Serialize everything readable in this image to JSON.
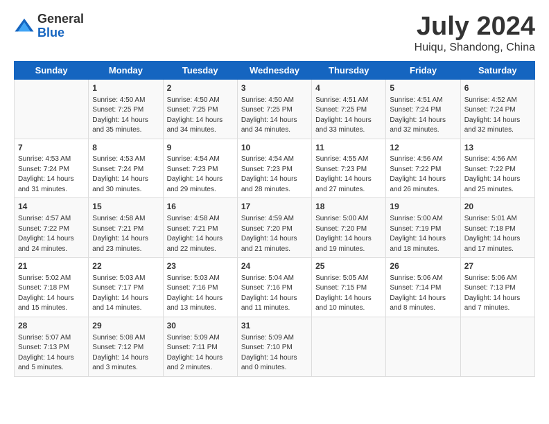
{
  "logo": {
    "general": "General",
    "blue": "Blue"
  },
  "title": "July 2024",
  "subtitle": "Huiqu, Shandong, China",
  "days_of_week": [
    "Sunday",
    "Monday",
    "Tuesday",
    "Wednesday",
    "Thursday",
    "Friday",
    "Saturday"
  ],
  "weeks": [
    [
      {
        "day": "",
        "content": ""
      },
      {
        "day": "1",
        "content": "Sunrise: 4:50 AM\nSunset: 7:25 PM\nDaylight: 14 hours\nand 35 minutes."
      },
      {
        "day": "2",
        "content": "Sunrise: 4:50 AM\nSunset: 7:25 PM\nDaylight: 14 hours\nand 34 minutes."
      },
      {
        "day": "3",
        "content": "Sunrise: 4:50 AM\nSunset: 7:25 PM\nDaylight: 14 hours\nand 34 minutes."
      },
      {
        "day": "4",
        "content": "Sunrise: 4:51 AM\nSunset: 7:25 PM\nDaylight: 14 hours\nand 33 minutes."
      },
      {
        "day": "5",
        "content": "Sunrise: 4:51 AM\nSunset: 7:24 PM\nDaylight: 14 hours\nand 32 minutes."
      },
      {
        "day": "6",
        "content": "Sunrise: 4:52 AM\nSunset: 7:24 PM\nDaylight: 14 hours\nand 32 minutes."
      }
    ],
    [
      {
        "day": "7",
        "content": "Sunrise: 4:53 AM\nSunset: 7:24 PM\nDaylight: 14 hours\nand 31 minutes."
      },
      {
        "day": "8",
        "content": "Sunrise: 4:53 AM\nSunset: 7:24 PM\nDaylight: 14 hours\nand 30 minutes."
      },
      {
        "day": "9",
        "content": "Sunrise: 4:54 AM\nSunset: 7:23 PM\nDaylight: 14 hours\nand 29 minutes."
      },
      {
        "day": "10",
        "content": "Sunrise: 4:54 AM\nSunset: 7:23 PM\nDaylight: 14 hours\nand 28 minutes."
      },
      {
        "day": "11",
        "content": "Sunrise: 4:55 AM\nSunset: 7:23 PM\nDaylight: 14 hours\nand 27 minutes."
      },
      {
        "day": "12",
        "content": "Sunrise: 4:56 AM\nSunset: 7:22 PM\nDaylight: 14 hours\nand 26 minutes."
      },
      {
        "day": "13",
        "content": "Sunrise: 4:56 AM\nSunset: 7:22 PM\nDaylight: 14 hours\nand 25 minutes."
      }
    ],
    [
      {
        "day": "14",
        "content": "Sunrise: 4:57 AM\nSunset: 7:22 PM\nDaylight: 14 hours\nand 24 minutes."
      },
      {
        "day": "15",
        "content": "Sunrise: 4:58 AM\nSunset: 7:21 PM\nDaylight: 14 hours\nand 23 minutes."
      },
      {
        "day": "16",
        "content": "Sunrise: 4:58 AM\nSunset: 7:21 PM\nDaylight: 14 hours\nand 22 minutes."
      },
      {
        "day": "17",
        "content": "Sunrise: 4:59 AM\nSunset: 7:20 PM\nDaylight: 14 hours\nand 21 minutes."
      },
      {
        "day": "18",
        "content": "Sunrise: 5:00 AM\nSunset: 7:20 PM\nDaylight: 14 hours\nand 19 minutes."
      },
      {
        "day": "19",
        "content": "Sunrise: 5:00 AM\nSunset: 7:19 PM\nDaylight: 14 hours\nand 18 minutes."
      },
      {
        "day": "20",
        "content": "Sunrise: 5:01 AM\nSunset: 7:18 PM\nDaylight: 14 hours\nand 17 minutes."
      }
    ],
    [
      {
        "day": "21",
        "content": "Sunrise: 5:02 AM\nSunset: 7:18 PM\nDaylight: 14 hours\nand 15 minutes."
      },
      {
        "day": "22",
        "content": "Sunrise: 5:03 AM\nSunset: 7:17 PM\nDaylight: 14 hours\nand 14 minutes."
      },
      {
        "day": "23",
        "content": "Sunrise: 5:03 AM\nSunset: 7:16 PM\nDaylight: 14 hours\nand 13 minutes."
      },
      {
        "day": "24",
        "content": "Sunrise: 5:04 AM\nSunset: 7:16 PM\nDaylight: 14 hours\nand 11 minutes."
      },
      {
        "day": "25",
        "content": "Sunrise: 5:05 AM\nSunset: 7:15 PM\nDaylight: 14 hours\nand 10 minutes."
      },
      {
        "day": "26",
        "content": "Sunrise: 5:06 AM\nSunset: 7:14 PM\nDaylight: 14 hours\nand 8 minutes."
      },
      {
        "day": "27",
        "content": "Sunrise: 5:06 AM\nSunset: 7:13 PM\nDaylight: 14 hours\nand 7 minutes."
      }
    ],
    [
      {
        "day": "28",
        "content": "Sunrise: 5:07 AM\nSunset: 7:13 PM\nDaylight: 14 hours\nand 5 minutes."
      },
      {
        "day": "29",
        "content": "Sunrise: 5:08 AM\nSunset: 7:12 PM\nDaylight: 14 hours\nand 3 minutes."
      },
      {
        "day": "30",
        "content": "Sunrise: 5:09 AM\nSunset: 7:11 PM\nDaylight: 14 hours\nand 2 minutes."
      },
      {
        "day": "31",
        "content": "Sunrise: 5:09 AM\nSunset: 7:10 PM\nDaylight: 14 hours\nand 0 minutes."
      },
      {
        "day": "",
        "content": ""
      },
      {
        "day": "",
        "content": ""
      },
      {
        "day": "",
        "content": ""
      }
    ]
  ]
}
